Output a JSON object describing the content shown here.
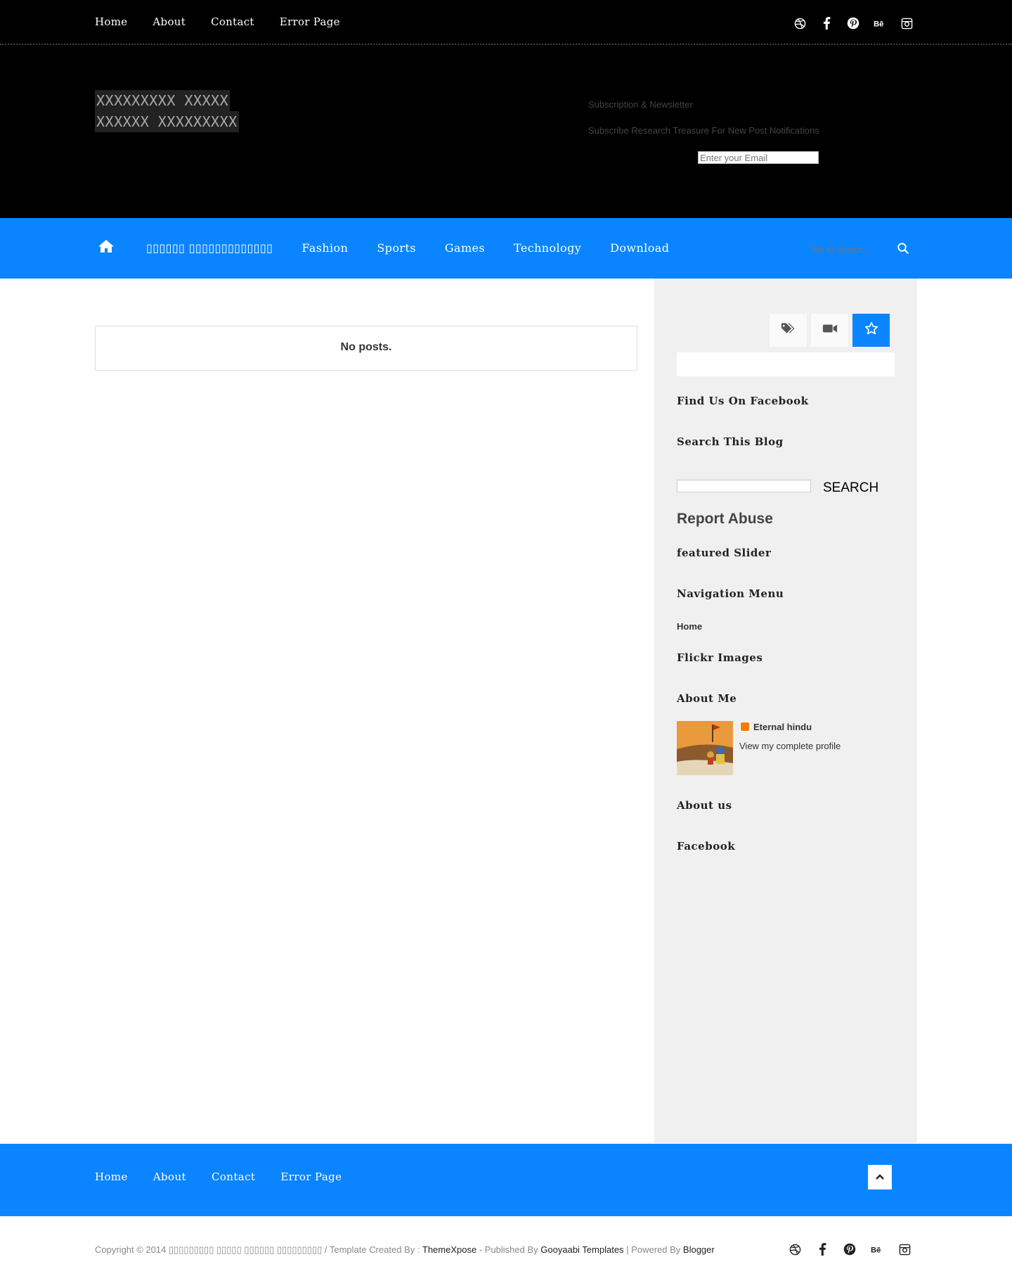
{
  "top_nav": [
    "Home",
    "About",
    "Contact",
    "Error Page"
  ],
  "social_icons": [
    "dribbble-icon",
    "facebook-icon",
    "pinterest-icon",
    "behance-icon",
    "instagram-icon"
  ],
  "header": {
    "logo_line1": "XXXXXXXXX XXXXX",
    "logo_line2": "XXXXXX XXXXXXXXX",
    "subscribe_title": "Subscription & Newsletter",
    "subscribe_desc": "Subscribe Research Treasure For New Post Notifications",
    "email_placeholder": "Enter your Email"
  },
  "main_nav": {
    "items": [
      "▯▯▯▯▯▯ ▯▯▯▯▯▯▯▯▯▯▯▯▯",
      "Fashion",
      "Sports",
      "Games",
      "Technology",
      "Download"
    ],
    "search_placeholder": "Text to Search...",
    "accent": "#0a84ff"
  },
  "content": {
    "no_posts": "No posts."
  },
  "sidebar": {
    "tab_icons": [
      "tags-icon",
      "video-icon",
      "star-icon"
    ],
    "find_facebook": "Find Us On Facebook",
    "search_blog": "Search This Blog",
    "search_button": "SEARCH",
    "report_abuse": "Report Abuse",
    "featured_slider": "featured Slider",
    "navigation_menu": "Navigation Menu",
    "nav_home": "Home",
    "flickr": "Flickr Images",
    "about_me": "About Me",
    "profile_name": "Eternal hindu",
    "profile_link": "View my complete profile",
    "about_us": "About us",
    "facebook": "Facebook"
  },
  "footer": {
    "nav": [
      "Home",
      "About",
      "Contact",
      "Error Page"
    ],
    "copyright_prefix": "Copyright © 2014 ▯▯▯▯▯▯▯▯▯ ▯▯▯▯▯ ▯▯▯▯▯▯ ▯▯▯▯▯▯▯▯▯ / Template Created By :",
    "themexpose": "ThemeXpose",
    "published_by": "- Published By",
    "gooyaabi": "Gooyaabi Templates",
    "powered_by": "| Powered By",
    "blogger": "Blogger"
  }
}
